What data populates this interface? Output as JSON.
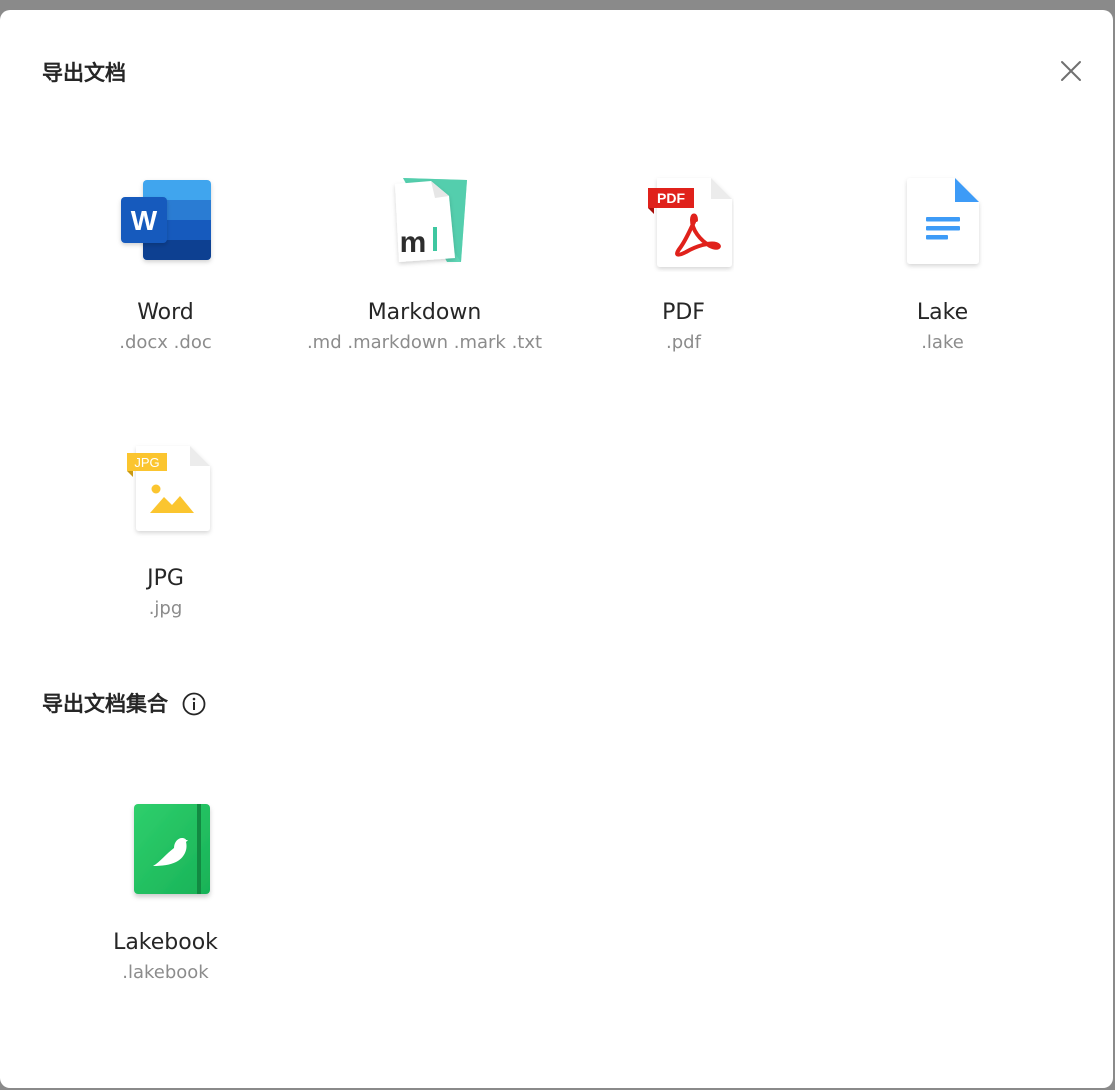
{
  "dialog": {
    "close_icon": "close-icon"
  },
  "export_documents": {
    "title": "导出文档",
    "items": [
      {
        "name": "Word",
        "ext": ".docx .doc",
        "icon": "word-icon",
        "accent": "#2b579a"
      },
      {
        "name": "Markdown",
        "ext": ".md .markdown .mark .txt",
        "icon": "markdown-icon",
        "accent": "#4dd4b0"
      },
      {
        "name": "PDF",
        "ext": ".pdf",
        "icon": "pdf-icon",
        "accent": "#e0211b"
      },
      {
        "name": "Lake",
        "ext": ".lake",
        "icon": "lake-file-icon",
        "accent": "#3d9bf7"
      },
      {
        "name": "JPG",
        "ext": ".jpg",
        "icon": "jpg-icon",
        "accent": "#fbc52f"
      }
    ]
  },
  "export_collection": {
    "title": "导出文档集合",
    "info_icon": "info-icon",
    "items": [
      {
        "name": "Lakebook",
        "ext": ".lakebook",
        "icon": "lakebook-icon",
        "accent": "#1fbd5e"
      }
    ]
  },
  "badges": {
    "word_letter": "W",
    "markdown_letter": "m",
    "pdf_badge": "PDF",
    "jpg_badge": "JPG"
  }
}
